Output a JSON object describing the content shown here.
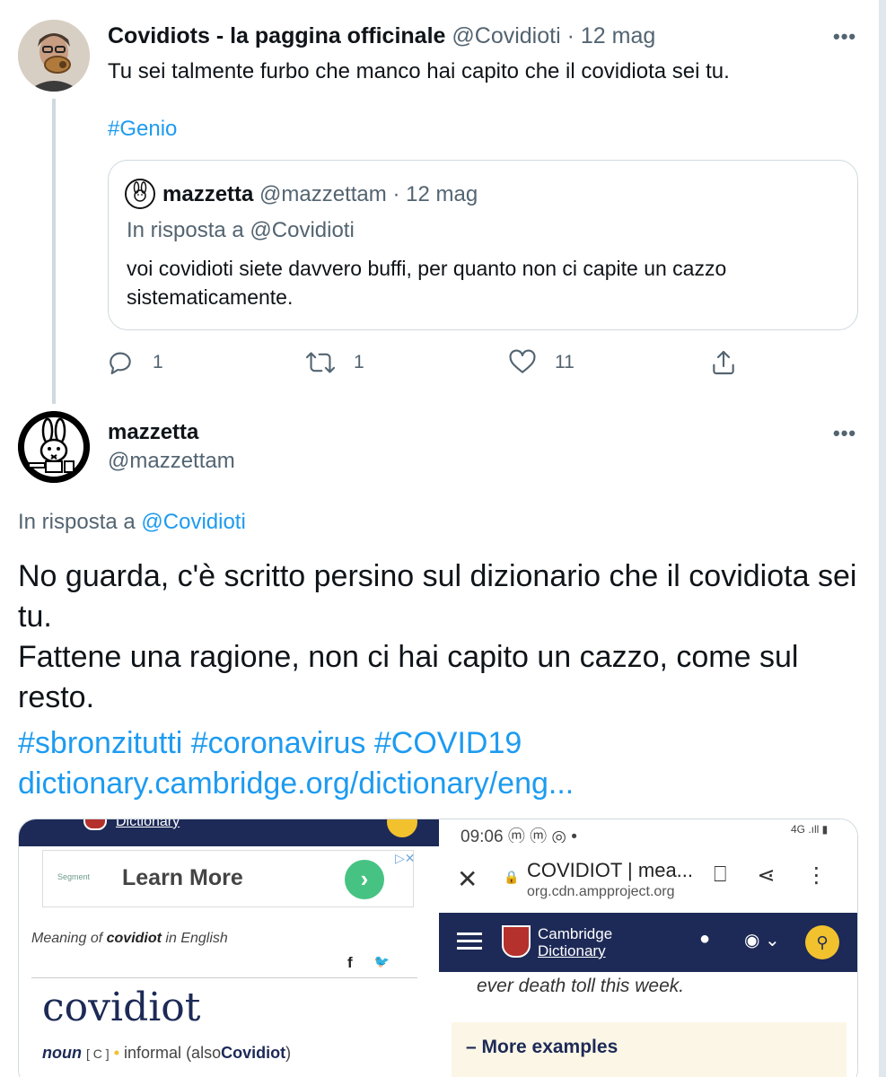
{
  "tweet1": {
    "name": "Covidiots - la paggina officinale",
    "handle": "@Covidioti",
    "date": "· 12 mag",
    "more": "•••",
    "text": "Tu sei talmente furbo che manco hai capito che il covidiota sei tu.",
    "hashtag": "#Genio",
    "quoted": {
      "name": "mazzetta",
      "handle": "@mazzettam",
      "date": "· 12 mag",
      "reply_prefix": "In risposta a",
      "reply_handle": "@Covidioti",
      "text": "voi covidioti siete davvero buffi, per quanto non ci capite un cazzo sistematicamente."
    },
    "actions": {
      "replies": "1",
      "retweets": "1",
      "likes": "11"
    }
  },
  "tweet2": {
    "name": "mazzetta",
    "handle": "@mazzettam",
    "more": "•••",
    "reply_prefix": "In risposta a",
    "reply_handle": "@Covidioti",
    "body": "No guarda, c'è scritto persino sul dizionario che il covidiota sei tu.\nFattene una ragione, non ci hai capito un cazzo, come sul resto.",
    "hashtags": "#sbronzitutti #coronavirus #COVID19",
    "link": "dictionary.cambridge.org/dictionary/eng..."
  },
  "media_left": {
    "logo_text": "Dictionary",
    "ad_brand": "Segment",
    "ad_cta": "Learn More",
    "ad_arrow": "›",
    "ad_close": "▷✕",
    "meaning_prefix": "Meaning of",
    "meaning_word": "covidiot",
    "meaning_suffix": "in English",
    "share_facebook": "f",
    "share_twitter": "🐦",
    "headword": "covidiot",
    "pos": "noun",
    "grammar": "[ C ]",
    "bullet": "•",
    "register": "informal",
    "also_prefix": "(also",
    "also_word": "Covidiot",
    "also_suffix": ")"
  },
  "media_right": {
    "time": "09:06 ⓜ ⓜ ◎ •",
    "signal": "4G .ıll ▮",
    "close": "✕",
    "lock": "🔒",
    "page_title": "COVIDIOT | mea...",
    "page_url": "org.cdn.ampproject.org",
    "bookmark": "⎕",
    "share": "⋖",
    "menu": "⋮",
    "cd_line1": "Cambridge",
    "cd_line2": "Dictionary",
    "person": "●",
    "globe": "◉ ⌄",
    "search": "⚲",
    "example": "ever death toll this week.",
    "more_examples": "–  More examples"
  },
  "colors": {
    "link_blue": "#1d9bf0",
    "secondary_text": "#536471",
    "border": "#cfd9de",
    "cambridge_navy": "#1d2a57",
    "cambridge_yellow": "#f2c12e"
  }
}
